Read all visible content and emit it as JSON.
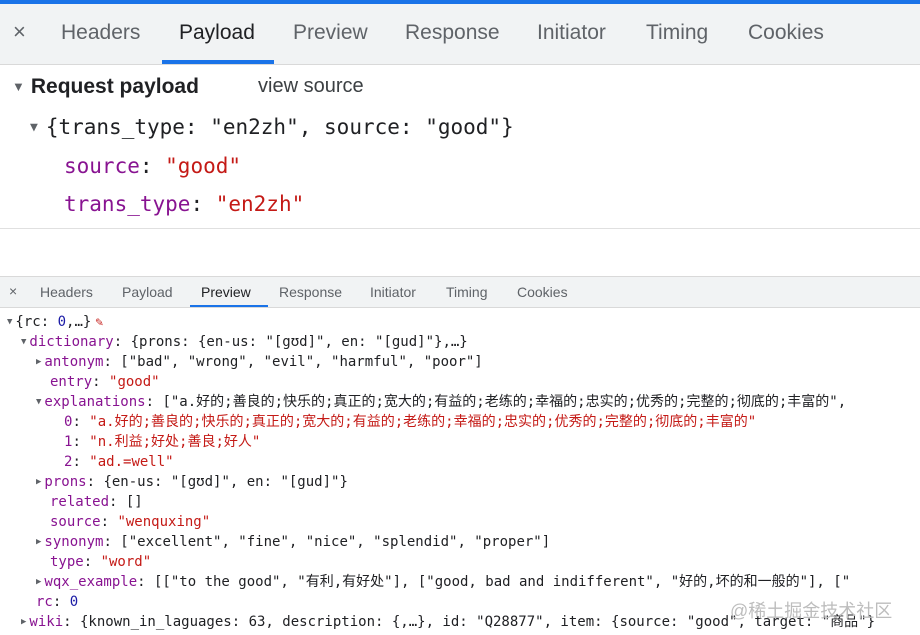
{
  "tabs_large": [
    "Headers",
    "Payload",
    "Preview",
    "Response",
    "Initiator",
    "Timing",
    "Cookies"
  ],
  "tabs_small": [
    "Headers",
    "Payload",
    "Preview",
    "Response",
    "Initiator",
    "Timing",
    "Cookies"
  ],
  "close_glyph": "×",
  "payload": {
    "title": "Request payload",
    "view_source": "view source",
    "summary_open": "{",
    "summary_k1": "trans_type",
    "summary_v1": "\"en2zh\"",
    "summary_k2": "source",
    "summary_v2": "\"good\"",
    "summary_close": "}",
    "fields": [
      {
        "key": "source",
        "value": "\"good\""
      },
      {
        "key": "trans_type",
        "value": "\"en2zh\""
      }
    ]
  },
  "tree": {
    "root_a": "{",
    "root_k": "rc",
    "root_v": "0",
    "root_b": ",…}",
    "dictionary_key": "dictionary",
    "dictionary_summary": "{prons: {en-us: \"[gʊd]\", en: \"[gud]\"},…}",
    "antonym_key": "antonym",
    "antonym_value": "[\"bad\", \"wrong\", \"evil\", \"harmful\", \"poor\"]",
    "entry_key": "entry",
    "entry_value": "\"good\"",
    "explanations_key": "explanations",
    "explanations_summary": "[\"a.好的;善良的;快乐的;真正的;宽大的;有益的;老练的;幸福的;忠实的;优秀的;完整的;彻底的;丰富的\",",
    "exp_items": [
      {
        "index": "0",
        "value": "\"a.好的;善良的;快乐的;真正的;宽大的;有益的;老练的;幸福的;忠实的;优秀的;完整的;彻底的;丰富的\""
      },
      {
        "index": "1",
        "value": "\"n.利益;好处;善良;好人\""
      },
      {
        "index": "2",
        "value": "\"ad.=well\""
      }
    ],
    "prons_key": "prons",
    "prons_value": "{en-us: \"[gʊd]\", en: \"[gud]\"}",
    "related_key": "related",
    "related_value": "[]",
    "source_key": "source",
    "source_value": "\"wenquxing\"",
    "synonym_key": "synonym",
    "synonym_value": "[\"excellent\", \"fine\", \"nice\", \"splendid\", \"proper\"]",
    "type_key": "type",
    "type_value": "\"word\"",
    "wqx_key": "wqx_example",
    "wqx_value": "[[\"to the good\", \"有利,有好处\"], [\"good, bad and indifferent\", \"好的,坏的和一般的\"], [\"",
    "rc_key": "rc",
    "rc_value": "0",
    "wiki_key": "wiki",
    "wiki_value": "{known_in_laguages: 63, description: {,…}, id: \"Q28877\", item: {source: \"good\", target: \"商品\"}"
  },
  "watermark": "@稀土掘金技术社区",
  "colors": {
    "accent": "#1a73e8",
    "key": "#881391",
    "string": "#c41a16",
    "number": "#1a1aa6"
  }
}
